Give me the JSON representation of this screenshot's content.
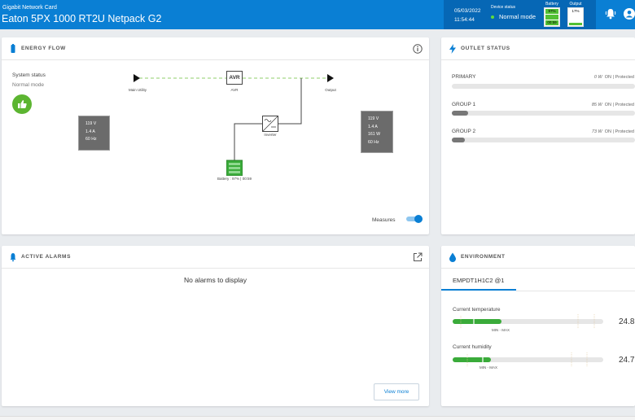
{
  "header": {
    "subtitle": "Gigabit Network Card",
    "title": "Eaton 5PX 1000 RT2U Netpack G2",
    "date": "05/03/2022",
    "time": "11:54:44",
    "device_status_label": "Device status",
    "device_status_value": "Normal mode",
    "battery_label": "Battery",
    "battery_pct": "97%",
    "battery_time": "00:59",
    "output_label": "Output",
    "output_pct": "17%",
    "alarm_icon": "bell-icon",
    "user_icon": "user-icon"
  },
  "energy_flow": {
    "title": "ENERGY FLOW",
    "system_status_label": "System status",
    "system_status_value": "Normal mode",
    "input": {
      "voltage": "119 V",
      "current": "1.4 A",
      "frequency": "60 Hz"
    },
    "output": {
      "voltage": "119 V",
      "current": "1.4 A",
      "power": "161 W",
      "frequency": "60 Hz"
    },
    "labels": {
      "main_utility": "Main Utility",
      "avr_box": "AVR",
      "avr": "AVR",
      "output": "Output",
      "inverter": "Inverter",
      "battery": "Battery : 97% | 00:59"
    },
    "measures_label": "Measures",
    "measures_on": true,
    "colors": {
      "status_green": "#5cb531",
      "flow_dash": "#8fcf6b",
      "battery": "#3aab3a"
    }
  },
  "outlet_status": {
    "title": "OUTLET STATUS",
    "items": [
      {
        "name": "PRIMARY",
        "value": "0 W",
        "status": "ON | Protected",
        "level": 0
      },
      {
        "name": "GROUP 1",
        "value": "85 W",
        "status": "ON | Protected",
        "level": 0.09
      },
      {
        "name": "GROUP 2",
        "value": "73 W",
        "status": "ON | Protected",
        "level": 0.07
      }
    ]
  },
  "alarms": {
    "title": "ACTIVE ALARMS",
    "empty_message": "No alarms to display",
    "view_more": "View more"
  },
  "environment": {
    "title": "ENVIRONMENT",
    "tab": "EMPDT1H1C2 @1",
    "temperature_label": "Current temperature",
    "temperature_value": "24.8",
    "humidity_label": "Current humidity",
    "humidity_value": "24.7",
    "minmax": "MIN - MAX"
  }
}
